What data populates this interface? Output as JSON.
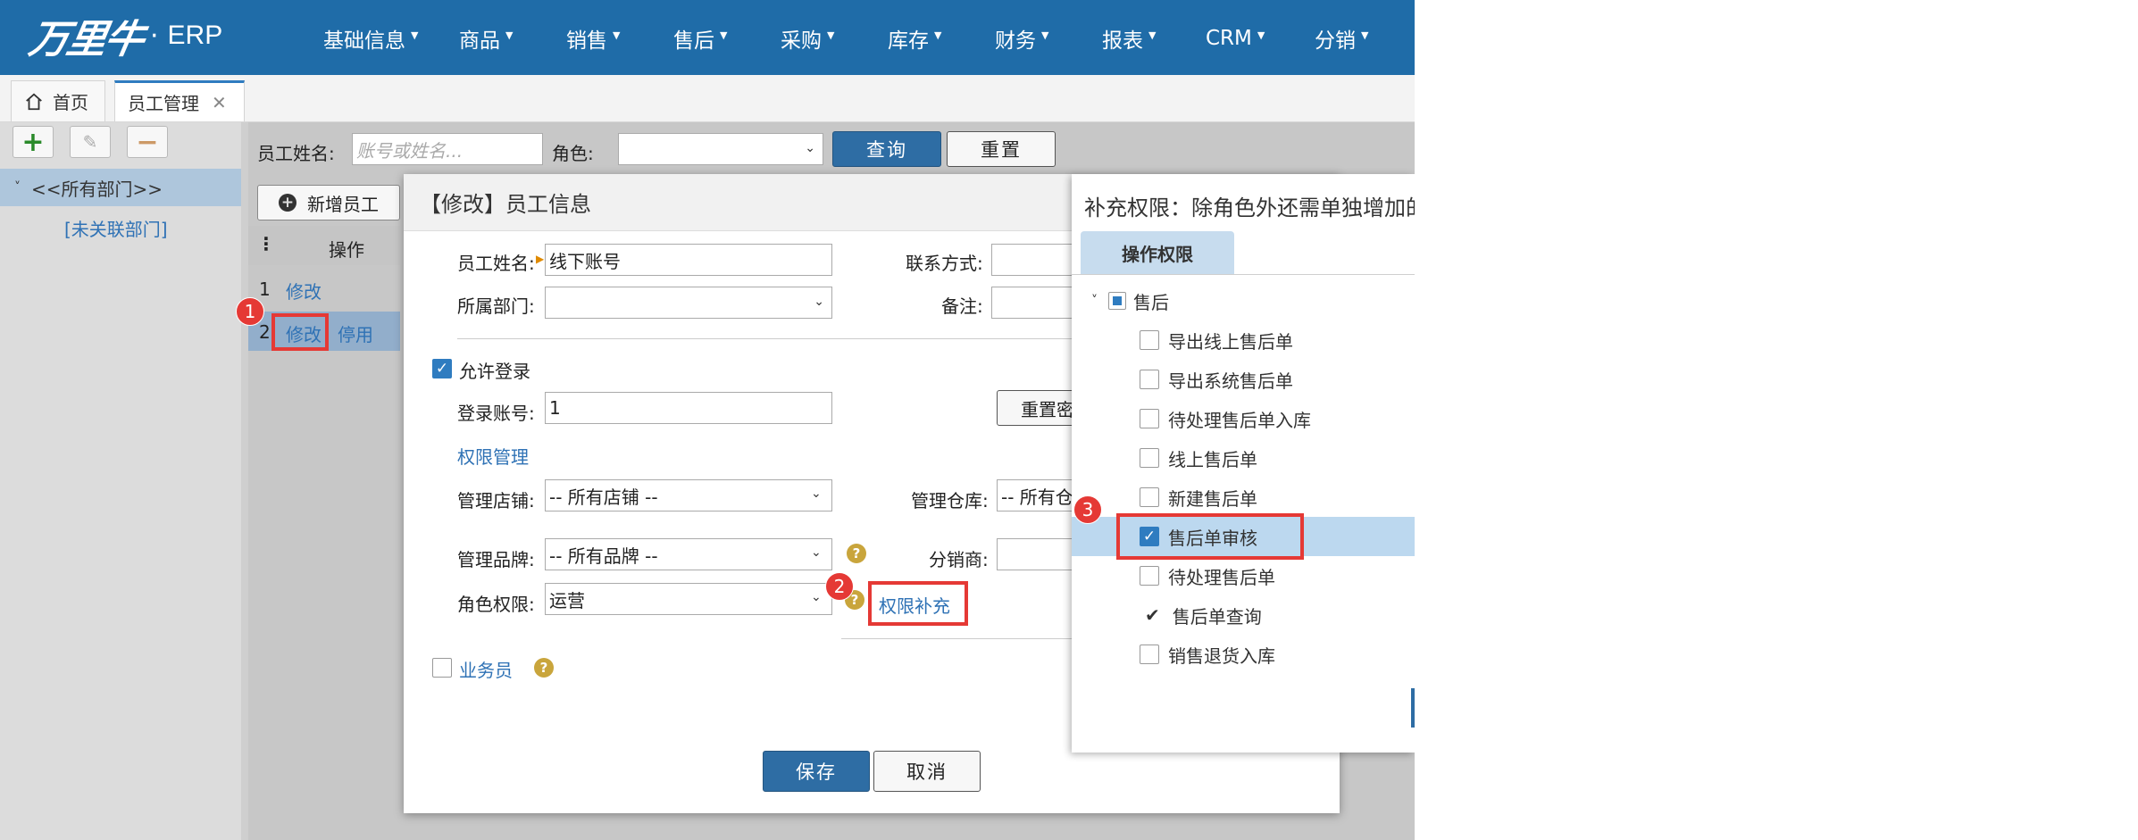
{
  "brand": {
    "mark": "万里牛",
    "dot": "·",
    "erp": "ERP"
  },
  "nav": [
    {
      "label": "基础信息"
    },
    {
      "label": "商品"
    },
    {
      "label": "销售"
    },
    {
      "label": "售后"
    },
    {
      "label": "采购"
    },
    {
      "label": "库存"
    },
    {
      "label": "财务"
    },
    {
      "label": "报表"
    },
    {
      "label": "CRM"
    },
    {
      "label": "分销"
    }
  ],
  "tabs": {
    "home": "首页",
    "active": "员工管理",
    "close": "✕"
  },
  "left": {
    "toolbar": {
      "add": "+",
      "edit": "✎",
      "remove": "−"
    },
    "tree_root": "<<所有部门>>",
    "tree_toggle": "˅",
    "tree_child": "[未关联部门]"
  },
  "filter": {
    "name_label": "员工姓名:",
    "name_placeholder": "账号或姓名...",
    "role_label": "角色:",
    "query": "查询",
    "reset": "重置"
  },
  "grid": {
    "new_button": "新增员工",
    "col_ops": "操作",
    "rows": [
      {
        "num": "1",
        "edit": "修改"
      },
      {
        "num": "2",
        "edit": "修改",
        "disable": "停用"
      }
    ]
  },
  "dialog": {
    "title": "【修改】员工信息",
    "name_label": "员工姓名:",
    "name_value": "线下账号",
    "contact_label": "联系方式:",
    "dept_label": "所属部门:",
    "remark_label": "备注:",
    "allow_login": "允许登录",
    "allow_login_checked": true,
    "login_label": "登录账号:",
    "login_value": "1",
    "reset_pwd": "重置密",
    "perm_section": "权限管理",
    "shop_label": "管理店铺:",
    "shop_value": "-- 所有店铺 --",
    "wh_label": "管理仓库:",
    "wh_value": "-- 所有仓",
    "brand_label": "管理品牌:",
    "brand_value": "-- 所有品牌 --",
    "dist_label": "分销商:",
    "role_label": "角色权限:",
    "role_value": "运营",
    "perm_link": "权限补充",
    "salesman": "业务员",
    "save": "保存",
    "cancel": "取消"
  },
  "perm_panel": {
    "title": "补充权限：除角色外还需单独增加的",
    "tab": "操作权限",
    "group": "售后",
    "items": [
      {
        "label": "导出线上售后单",
        "checked": false
      },
      {
        "label": "导出系统售后单",
        "checked": false
      },
      {
        "label": "待处理售后单入库",
        "checked": false
      },
      {
        "label": "线上售后单",
        "checked": false
      },
      {
        "label": "新建售后单",
        "checked": false
      },
      {
        "label": "售后单审核",
        "checked": true
      },
      {
        "label": "待处理售后单",
        "checked": false
      },
      {
        "label": "售后单查询",
        "checked": "inherited"
      },
      {
        "label": "销售退货入库",
        "checked": false
      }
    ]
  },
  "annotations": {
    "badge1": "1",
    "badge2": "2",
    "badge3": "3"
  },
  "colors": {
    "header": "#1f6ca8",
    "accent": "#2e6da4",
    "highlight": "#e53935",
    "selected_row": "#bcd8ef"
  }
}
